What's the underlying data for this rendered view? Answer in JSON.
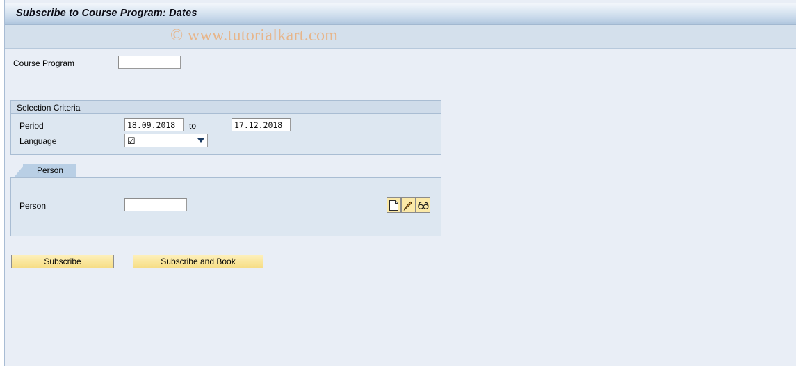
{
  "window": {
    "title": "Subscribe to Course Program: Dates"
  },
  "watermark": {
    "text": "© www.tutorialkart.com",
    "color": "#e7b58a"
  },
  "form": {
    "course_program": {
      "label": "Course Program",
      "value": "",
      "placeholder": ""
    }
  },
  "selection_criteria": {
    "title": "Selection Criteria",
    "period": {
      "label": "Period",
      "from_value": "18.09.2018",
      "to_label": "to",
      "to_value": "17.12.2018"
    },
    "language": {
      "label": "Language",
      "value": "☑",
      "arrow_icon": "chevron-down-icon"
    }
  },
  "tabs": [
    {
      "label": "Person",
      "active": true
    }
  ],
  "person_tab": {
    "person": {
      "label": "Person",
      "value": "",
      "placeholder": ""
    },
    "icons": [
      {
        "name": "create-icon",
        "glyph": "page"
      },
      {
        "name": "edit-icon",
        "glyph": "pencil"
      },
      {
        "name": "display-icon",
        "glyph": "glasses"
      }
    ]
  },
  "actions": {
    "subscribe_label": "Subscribe",
    "subscribe_and_book_label": "Subscribe and Book"
  },
  "colors": {
    "page_background": "#e9eef6",
    "panel_background": "#dde7f1",
    "panel_border": "#a9bdd3",
    "title_bar_top": "#f2f6fb",
    "title_bar_bottom": "#aec5dd",
    "watermark_band": "#d4e0ec",
    "tab_active": "#b9cfe5",
    "button_yellow": "#fae79e",
    "icon_button_yellow": "#fbe9a8"
  }
}
